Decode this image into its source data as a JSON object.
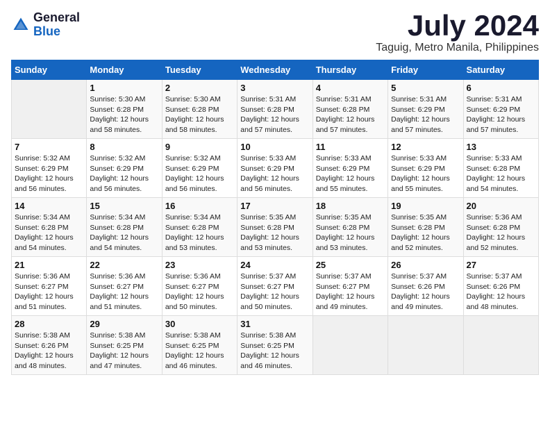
{
  "header": {
    "logo_general": "General",
    "logo_blue": "Blue",
    "month": "July 2024",
    "location": "Taguig, Metro Manila, Philippines"
  },
  "days_of_week": [
    "Sunday",
    "Monday",
    "Tuesday",
    "Wednesday",
    "Thursday",
    "Friday",
    "Saturday"
  ],
  "weeks": [
    [
      {
        "day": "",
        "info": ""
      },
      {
        "day": "1",
        "info": "Sunrise: 5:30 AM\nSunset: 6:28 PM\nDaylight: 12 hours\nand 58 minutes."
      },
      {
        "day": "2",
        "info": "Sunrise: 5:30 AM\nSunset: 6:28 PM\nDaylight: 12 hours\nand 58 minutes."
      },
      {
        "day": "3",
        "info": "Sunrise: 5:31 AM\nSunset: 6:28 PM\nDaylight: 12 hours\nand 57 minutes."
      },
      {
        "day": "4",
        "info": "Sunrise: 5:31 AM\nSunset: 6:28 PM\nDaylight: 12 hours\nand 57 minutes."
      },
      {
        "day": "5",
        "info": "Sunrise: 5:31 AM\nSunset: 6:29 PM\nDaylight: 12 hours\nand 57 minutes."
      },
      {
        "day": "6",
        "info": "Sunrise: 5:31 AM\nSunset: 6:29 PM\nDaylight: 12 hours\nand 57 minutes."
      }
    ],
    [
      {
        "day": "7",
        "info": "Sunrise: 5:32 AM\nSunset: 6:29 PM\nDaylight: 12 hours\nand 56 minutes."
      },
      {
        "day": "8",
        "info": "Sunrise: 5:32 AM\nSunset: 6:29 PM\nDaylight: 12 hours\nand 56 minutes."
      },
      {
        "day": "9",
        "info": "Sunrise: 5:32 AM\nSunset: 6:29 PM\nDaylight: 12 hours\nand 56 minutes."
      },
      {
        "day": "10",
        "info": "Sunrise: 5:33 AM\nSunset: 6:29 PM\nDaylight: 12 hours\nand 56 minutes."
      },
      {
        "day": "11",
        "info": "Sunrise: 5:33 AM\nSunset: 6:29 PM\nDaylight: 12 hours\nand 55 minutes."
      },
      {
        "day": "12",
        "info": "Sunrise: 5:33 AM\nSunset: 6:29 PM\nDaylight: 12 hours\nand 55 minutes."
      },
      {
        "day": "13",
        "info": "Sunrise: 5:33 AM\nSunset: 6:28 PM\nDaylight: 12 hours\nand 54 minutes."
      }
    ],
    [
      {
        "day": "14",
        "info": "Sunrise: 5:34 AM\nSunset: 6:28 PM\nDaylight: 12 hours\nand 54 minutes."
      },
      {
        "day": "15",
        "info": "Sunrise: 5:34 AM\nSunset: 6:28 PM\nDaylight: 12 hours\nand 54 minutes."
      },
      {
        "day": "16",
        "info": "Sunrise: 5:34 AM\nSunset: 6:28 PM\nDaylight: 12 hours\nand 53 minutes."
      },
      {
        "day": "17",
        "info": "Sunrise: 5:35 AM\nSunset: 6:28 PM\nDaylight: 12 hours\nand 53 minutes."
      },
      {
        "day": "18",
        "info": "Sunrise: 5:35 AM\nSunset: 6:28 PM\nDaylight: 12 hours\nand 53 minutes."
      },
      {
        "day": "19",
        "info": "Sunrise: 5:35 AM\nSunset: 6:28 PM\nDaylight: 12 hours\nand 52 minutes."
      },
      {
        "day": "20",
        "info": "Sunrise: 5:36 AM\nSunset: 6:28 PM\nDaylight: 12 hours\nand 52 minutes."
      }
    ],
    [
      {
        "day": "21",
        "info": "Sunrise: 5:36 AM\nSunset: 6:27 PM\nDaylight: 12 hours\nand 51 minutes."
      },
      {
        "day": "22",
        "info": "Sunrise: 5:36 AM\nSunset: 6:27 PM\nDaylight: 12 hours\nand 51 minutes."
      },
      {
        "day": "23",
        "info": "Sunrise: 5:36 AM\nSunset: 6:27 PM\nDaylight: 12 hours\nand 50 minutes."
      },
      {
        "day": "24",
        "info": "Sunrise: 5:37 AM\nSunset: 6:27 PM\nDaylight: 12 hours\nand 50 minutes."
      },
      {
        "day": "25",
        "info": "Sunrise: 5:37 AM\nSunset: 6:27 PM\nDaylight: 12 hours\nand 49 minutes."
      },
      {
        "day": "26",
        "info": "Sunrise: 5:37 AM\nSunset: 6:26 PM\nDaylight: 12 hours\nand 49 minutes."
      },
      {
        "day": "27",
        "info": "Sunrise: 5:37 AM\nSunset: 6:26 PM\nDaylight: 12 hours\nand 48 minutes."
      }
    ],
    [
      {
        "day": "28",
        "info": "Sunrise: 5:38 AM\nSunset: 6:26 PM\nDaylight: 12 hours\nand 48 minutes."
      },
      {
        "day": "29",
        "info": "Sunrise: 5:38 AM\nSunset: 6:25 PM\nDaylight: 12 hours\nand 47 minutes."
      },
      {
        "day": "30",
        "info": "Sunrise: 5:38 AM\nSunset: 6:25 PM\nDaylight: 12 hours\nand 46 minutes."
      },
      {
        "day": "31",
        "info": "Sunrise: 5:38 AM\nSunset: 6:25 PM\nDaylight: 12 hours\nand 46 minutes."
      },
      {
        "day": "",
        "info": ""
      },
      {
        "day": "",
        "info": ""
      },
      {
        "day": "",
        "info": ""
      }
    ]
  ]
}
